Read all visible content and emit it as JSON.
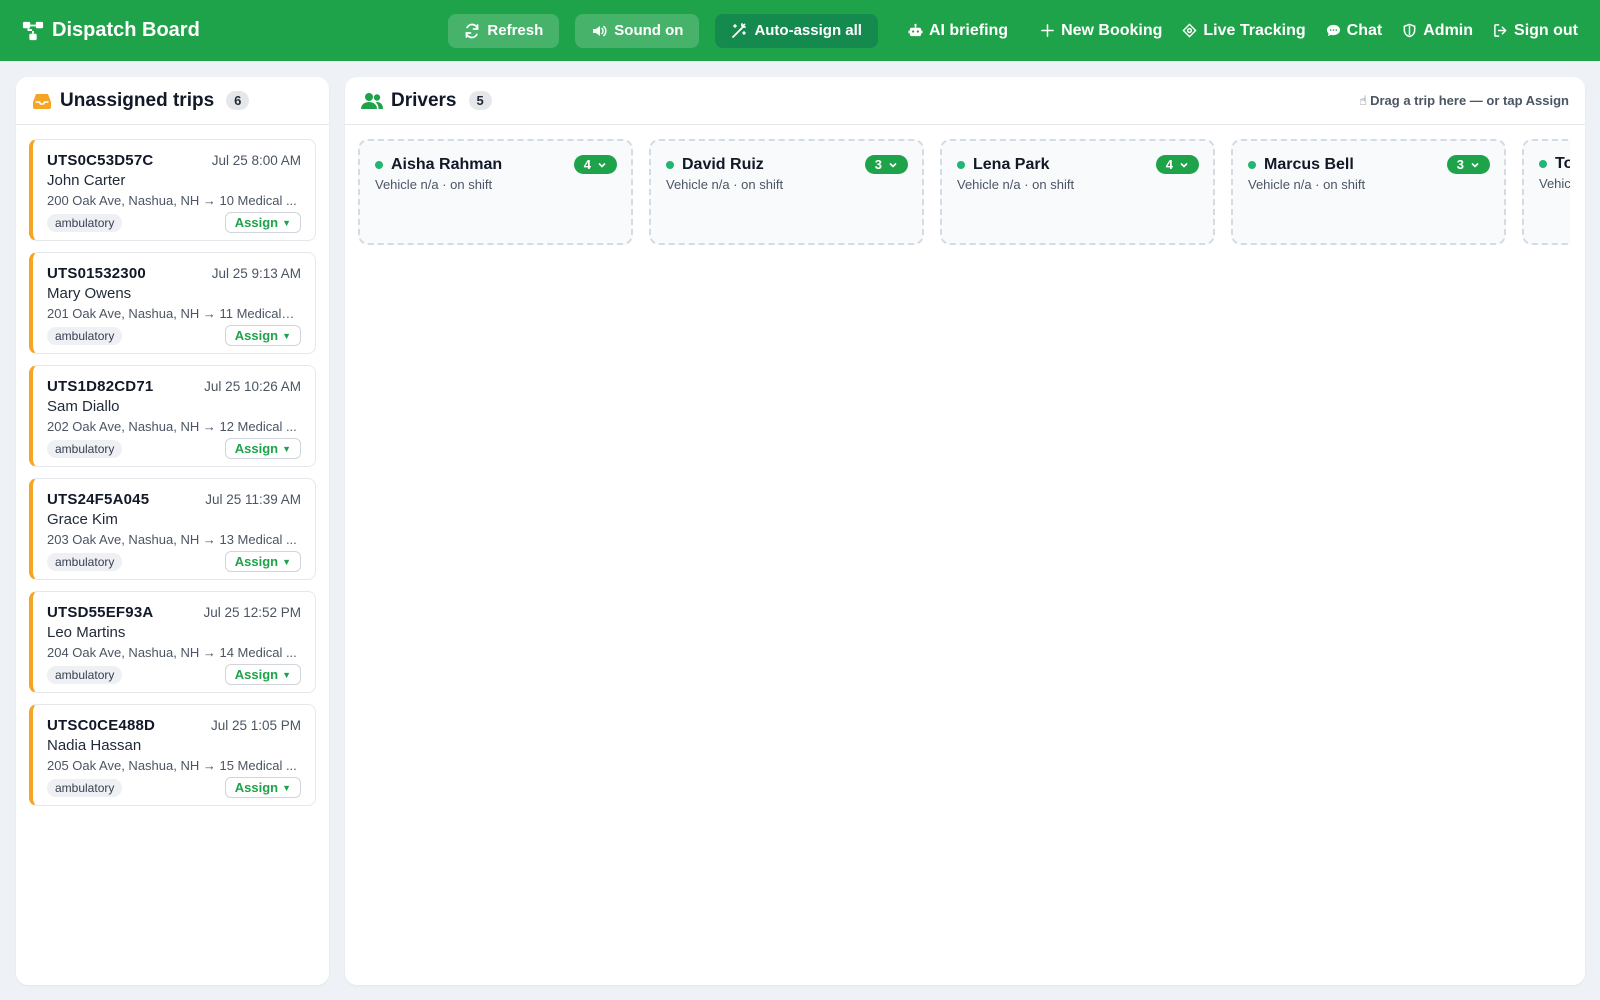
{
  "header": {
    "title": "Dispatch Board",
    "buttons": {
      "refresh": "Refresh",
      "sound": "Sound on",
      "auto_assign": "Auto-assign all",
      "ai_briefing": "AI briefing"
    },
    "nav": {
      "new_booking": "New Booking",
      "live_tracking": "Live Tracking",
      "chat": "Chat",
      "admin": "Admin",
      "sign_out": "Sign out"
    }
  },
  "unassigned": {
    "title": "Unassigned trips",
    "count": "6",
    "assign_label": "Assign",
    "trips": [
      {
        "id": "UTS0C53D57C",
        "time": "Jul 25 8:00 AM",
        "name": "John Carter",
        "route": "200 Oak Ave, Nashua, NH → 10 Medical ...",
        "tag": "ambulatory"
      },
      {
        "id": "UTS01532300",
        "time": "Jul 25 9:13 AM",
        "name": "Mary Owens",
        "route": "201 Oak Ave, Nashua, NH → 11 Medical C...",
        "tag": "ambulatory"
      },
      {
        "id": "UTS1D82CD71",
        "time": "Jul 25 10:26 AM",
        "name": "Sam Diallo",
        "route": "202 Oak Ave, Nashua, NH → 12 Medical ...",
        "tag": "ambulatory"
      },
      {
        "id": "UTS24F5A045",
        "time": "Jul 25 11:39 AM",
        "name": "Grace Kim",
        "route": "203 Oak Ave, Nashua, NH → 13 Medical ...",
        "tag": "ambulatory"
      },
      {
        "id": "UTSD55EF93A",
        "time": "Jul 25 12:52 PM",
        "name": "Leo Martins",
        "route": "204 Oak Ave, Nashua, NH → 14 Medical ...",
        "tag": "ambulatory"
      },
      {
        "id": "UTSC0CE488D",
        "time": "Jul 25 1:05 PM",
        "name": "Nadia Hassan",
        "route": "205 Oak Ave, Nashua, NH → 15 Medical ...",
        "tag": "ambulatory"
      }
    ]
  },
  "drivers": {
    "title": "Drivers",
    "count": "5",
    "hint": "Drag a trip here — or tap Assign",
    "list": [
      {
        "name": "Aisha Rahman",
        "sub": "Vehicle n/a · on shift",
        "load": "4"
      },
      {
        "name": "David Ruiz",
        "sub": "Vehicle n/a · on shift",
        "load": "3"
      },
      {
        "name": "Lena Park",
        "sub": "Vehicle n/a · on shift",
        "load": "4"
      },
      {
        "name": "Marcus Bell",
        "sub": "Vehicle n/a · on shift",
        "load": "3"
      },
      {
        "name": "To",
        "sub": "Vehic",
        "load": ""
      }
    ]
  },
  "colors": {
    "brand_green": "#1fa34a",
    "trip_accent": "#f5a524",
    "status_dot": "#22b573"
  },
  "icons": {
    "brand": "network-icon",
    "refresh": "refresh-icon",
    "sound": "speaker-icon",
    "auto_assign": "magic-wand-icon",
    "ai_briefing": "robot-icon",
    "new_booking": "plus-icon",
    "live_tracking": "location-icon",
    "chat": "chat-icon",
    "admin": "shield-icon",
    "sign_out": "sign-out-icon",
    "unassigned": "inbox-icon",
    "drivers": "users-icon",
    "hint": "pointer-icon"
  }
}
